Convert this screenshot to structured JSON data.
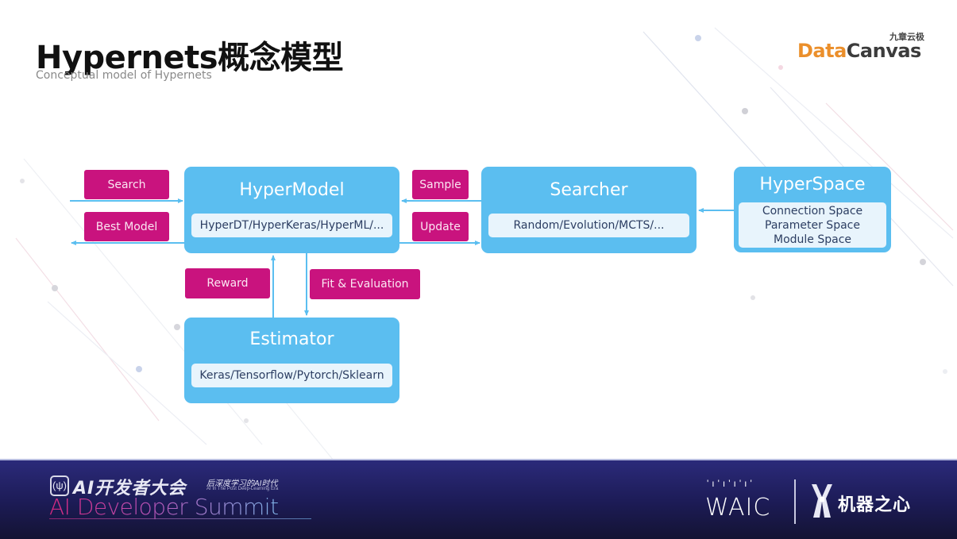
{
  "header": {
    "title": "Hypernets概念模型",
    "subtitle": "Conceptual model of Hypernets"
  },
  "logo": {
    "cn": "九章云极",
    "part1": "Data",
    "part2": "Canvas",
    "colors": {
      "data": "#eb8f2b",
      "canvas": "#3c3c3c"
    }
  },
  "diagram": {
    "colors": {
      "box": "#5bbef0",
      "inner": "#e8f4fc",
      "tag": "#c9137e",
      "arrow": "#5bbef0"
    },
    "boxes": {
      "hypermodel": {
        "title": "HyperModel",
        "content": "HyperDT/HyperKeras/HyperML/..."
      },
      "searcher": {
        "title": "Searcher",
        "content": "Random/Evolution/MCTS/..."
      },
      "hyperspace": {
        "title": "HyperSpace",
        "content": [
          "Connection Space",
          "Parameter Space",
          "Module Space"
        ]
      },
      "estimator": {
        "title": "Estimator",
        "content": "Keras/Tensorflow/Pytorch/Sklearn"
      }
    },
    "tags": {
      "search": "Search",
      "best_model": "Best Model",
      "sample": "Sample",
      "update": "Update",
      "reward": "Reward",
      "fit_evaluation": "Fit & Evaluation"
    }
  },
  "footer": {
    "event_cn": "AI开发者大会",
    "tagline_cn": "后深度学习的AI时代",
    "tagline_en": "AI In The Post Deep-Learning Era",
    "event_en": "AI Developer Summit",
    "waic": "WAIC",
    "partner_cn": "机器之心"
  }
}
